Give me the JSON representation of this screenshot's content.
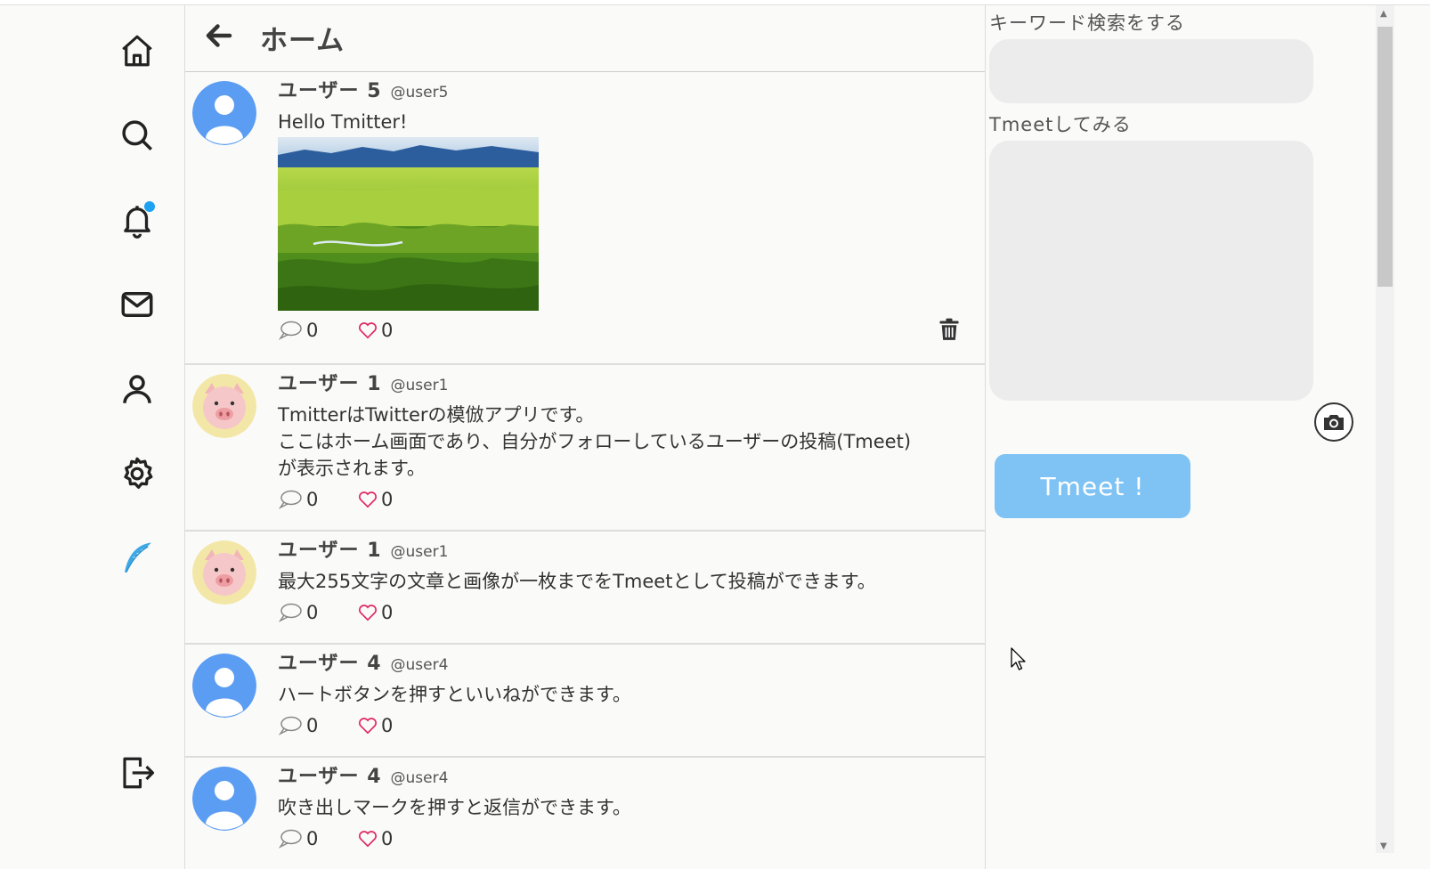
{
  "header": {
    "title": "ホーム"
  },
  "nav": {
    "items": [
      "home-icon",
      "search-icon",
      "bell-icon",
      "mail-icon",
      "person-icon",
      "gear-icon",
      "feather-icon",
      "logout-icon"
    ],
    "notification_dot": true,
    "accent_color": "#1da1f2"
  },
  "tweets": [
    {
      "name": "ユーザー 5",
      "handle": "@user5",
      "text": "Hello Tmitter!",
      "has_image": true,
      "replies": "0",
      "likes": "0",
      "deletable": true,
      "avatar": "person"
    },
    {
      "name": "ユーザー 1",
      "handle": "@user1",
      "text": "TmitterはTwitterの模倣アプリです。\nここはホーム画面であり、自分がフォローしているユーザーの投稿(Tmeet)が表示されます。",
      "has_image": false,
      "replies": "0",
      "likes": "0",
      "deletable": false,
      "avatar": "pig"
    },
    {
      "name": "ユーザー 1",
      "handle": "@user1",
      "text": "最大255文字の文章と画像が一枚までをTmeetとして投稿ができます。",
      "has_image": false,
      "replies": "0",
      "likes": "0",
      "deletable": false,
      "avatar": "pig"
    },
    {
      "name": "ユーザー 4",
      "handle": "@user4",
      "text": "ハートボタンを押すといいねができます。",
      "has_image": false,
      "replies": "0",
      "likes": "0",
      "deletable": false,
      "avatar": "person"
    },
    {
      "name": "ユーザー 4",
      "handle": "@user4",
      "text": "吹き出しマークを押すと返信ができます。",
      "has_image": false,
      "replies": "0",
      "likes": "0",
      "deletable": false,
      "avatar": "person"
    }
  ],
  "right": {
    "search_label": "キーワード検索をする",
    "search_value": "",
    "tmeet_label": "Tmeetしてみる",
    "tmeet_value": "",
    "tmeet_button": "Tmeet !",
    "button_color": "#7ec3f3"
  }
}
